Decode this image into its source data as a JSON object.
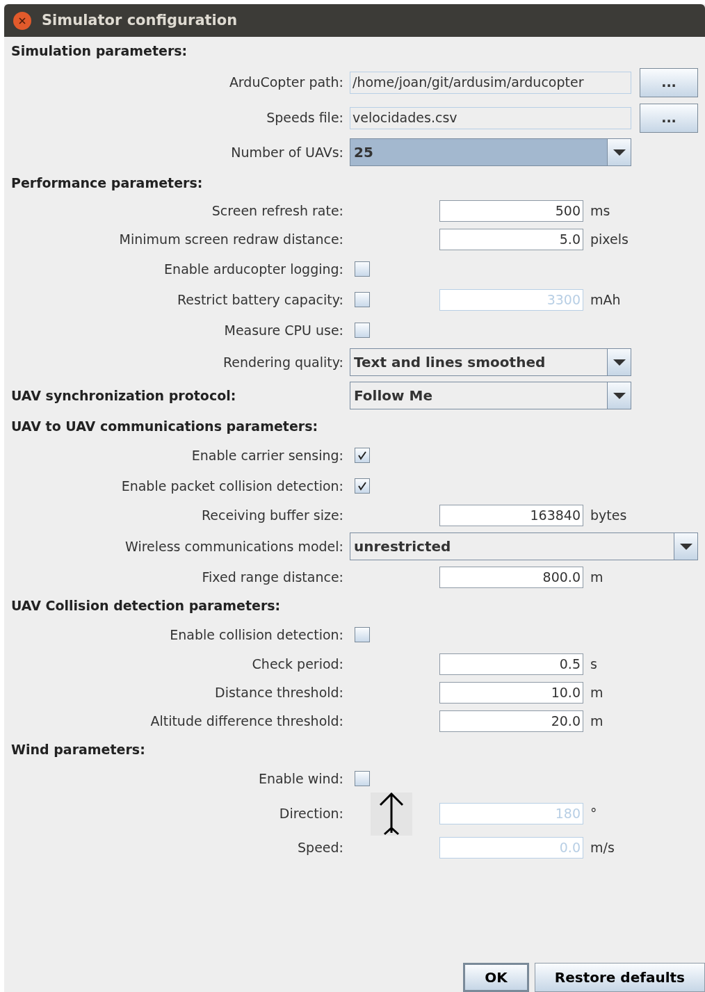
{
  "window": {
    "title": "Simulator configuration"
  },
  "sections": [
    {
      "title": "Simulation parameters:",
      "rows": [
        {
          "kind": "path",
          "label": "ArduCopter path:",
          "value": "/home/joan/git/ardusim/arducopter",
          "button": "..."
        },
        {
          "kind": "path",
          "label": "Speeds file:",
          "value": "velocidades.csv",
          "button": "..."
        },
        {
          "kind": "combo",
          "label": "Number of UAVs:",
          "value": "25",
          "focused": true,
          "wide": false
        }
      ]
    },
    {
      "title": "Performance parameters:",
      "rows": [
        {
          "kind": "number",
          "label": "Screen refresh rate:",
          "value": "500",
          "unit": "ms",
          "disabled": false
        },
        {
          "kind": "number",
          "label": "Minimum screen redraw distance:",
          "value": "5.0",
          "unit": "pixels",
          "disabled": false
        },
        {
          "kind": "checkbox",
          "label": "Enable arducopter logging:",
          "checked": false
        },
        {
          "kind": "checkbox",
          "label": "Restrict battery capacity:",
          "checked": false,
          "field": {
            "value": "3300",
            "unit": "mAh",
            "disabled": true
          }
        },
        {
          "kind": "checkbox",
          "label": "Measure CPU use:",
          "checked": false
        },
        {
          "kind": "combo",
          "label": "Rendering quality:",
          "value": "Text and lines smoothed",
          "focused": false,
          "wide": false
        }
      ]
    },
    {
      "title": "UAV synchronization protocol:",
      "combo": {
        "value": "Follow Me",
        "focused": false
      }
    },
    {
      "title": "UAV to UAV communications parameters:",
      "rows": [
        {
          "kind": "checkbox",
          "label": "Enable carrier sensing:",
          "checked": true
        },
        {
          "kind": "checkbox",
          "label": "Enable packet collision detection:",
          "checked": true
        },
        {
          "kind": "number",
          "label": "Receiving buffer size:",
          "value": "163840",
          "unit": "bytes",
          "disabled": false
        },
        {
          "kind": "combo",
          "label": "Wireless communications model:",
          "value": "unrestricted",
          "focused": false,
          "wide": true
        },
        {
          "kind": "number",
          "label": "Fixed range distance:",
          "value": "800.0",
          "unit": "m",
          "disabled": false
        }
      ]
    },
    {
      "title": "UAV Collision detection parameters:",
      "rows": [
        {
          "kind": "checkbox",
          "label": "Enable collision detection:",
          "checked": false
        },
        {
          "kind": "number",
          "label": "Check period:",
          "value": "0.5",
          "unit": "s",
          "disabled": false
        },
        {
          "kind": "number",
          "label": "Distance threshold:",
          "value": "10.0",
          "unit": "m",
          "disabled": false
        },
        {
          "kind": "number",
          "label": "Altitude difference threshold:",
          "value": "20.0",
          "unit": "m",
          "disabled": false
        }
      ]
    },
    {
      "title": "Wind parameters:",
      "rows": [
        {
          "kind": "checkbox",
          "label": "Enable wind:",
          "checked": false
        },
        {
          "kind": "direction",
          "label": "Direction:",
          "value": "180",
          "unit": "°",
          "disabled": true
        },
        {
          "kind": "number",
          "label": "Speed:",
          "value": "0.0",
          "unit": "m/s",
          "disabled": true
        }
      ]
    }
  ],
  "buttons": [
    {
      "label": "OK",
      "default": true
    },
    {
      "label": "Restore defaults",
      "default": false
    }
  ]
}
